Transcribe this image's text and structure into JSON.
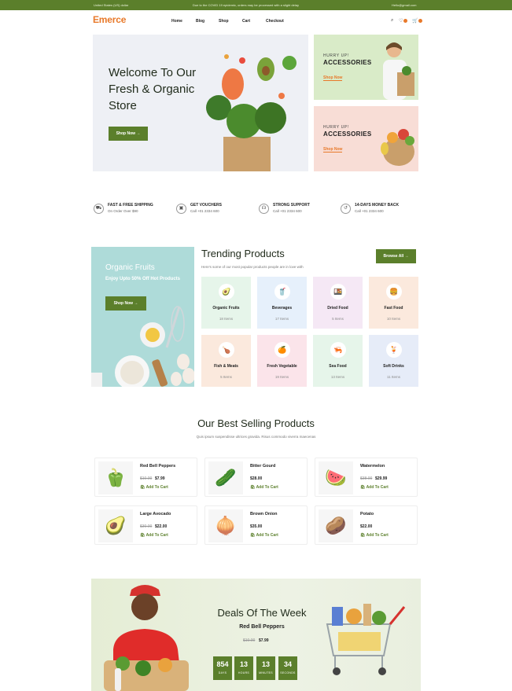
{
  "topbar": {
    "region": "United States (US) dollar",
    "notice": "Due to the COVID 19 epidemic, orders may be processed with a slight delay",
    "email": "Hello@gmail.com"
  },
  "header": {
    "logo": "Emerce",
    "nav": [
      "Home",
      "Blog",
      "Shop",
      "Cart",
      "Checkout"
    ]
  },
  "hero": {
    "title": "Welcome To Our Fresh & Organic Store",
    "cta": "Shop Now →"
  },
  "promos": [
    {
      "eyebrow": "HURRY UP!",
      "title": "ACCESSORIES",
      "link": "Shop Now",
      "bg": "#d9ebc8"
    },
    {
      "eyebrow": "HURRY UP!",
      "title": "ACCESSORIES",
      "link": "Shop Now",
      "bg": "#f8ddd6"
    }
  ],
  "features": [
    {
      "icon": "truck-icon",
      "title": "FAST & FREE SHIPPING",
      "sub": "On Order Over $90"
    },
    {
      "icon": "gift-icon",
      "title": "GET VOUCHERS",
      "sub": "Call +01 2334 600"
    },
    {
      "icon": "headset-icon",
      "title": "STRONG SUPPORT",
      "sub": "Call +01 2334 600"
    },
    {
      "icon": "refund-icon",
      "title": "14-DAYS MONEY BACK",
      "sub": "Call +01 2334 600"
    }
  ],
  "side_banner": {
    "title": "Organic Fruits",
    "subtitle": "Enjoy Upto 50% Off Hot Products",
    "cta": "Shop Now →"
  },
  "trending": {
    "title": "Trending Products",
    "subtitle": "Here's some of our most popular products people are in love with",
    "browse": "Browse All →",
    "categories": [
      {
        "name": "Organic Fruits",
        "count": "18 Items",
        "bg": "#e6f5ea",
        "icon": "🥑"
      },
      {
        "name": "Beverages",
        "count": "17 Items",
        "bg": "#e6f0fb",
        "icon": "🥤"
      },
      {
        "name": "Dried Food",
        "count": "5 Items",
        "bg": "#f5e8f5",
        "icon": "🍱"
      },
      {
        "name": "Fast Food",
        "count": "10 Items",
        "bg": "#fbe9dd",
        "icon": "🍔"
      },
      {
        "name": "Fish & Meats",
        "count": "5 Items",
        "bg": "#fbe9dd",
        "icon": "🍗"
      },
      {
        "name": "Fresh Vegetable",
        "count": "19 Items",
        "bg": "#fbe4ea",
        "icon": "🍊"
      },
      {
        "name": "Sea Food",
        "count": "13 Items",
        "bg": "#e6f5ea",
        "icon": "🦐"
      },
      {
        "name": "Soft Drinks",
        "count": "11 Items",
        "bg": "#e6ecf8",
        "icon": "🍹"
      }
    ]
  },
  "best_selling": {
    "title": "Our Best Selling Products",
    "subtitle": "Quis ipsum suspendisse ultrices gravida. Risus commodo viverra maecenas",
    "cart_label": "Add To Cart",
    "products": [
      {
        "name": "Red Bell Peppers",
        "old": "$10.00",
        "price": "$7.99",
        "icon": "🫑"
      },
      {
        "name": "Bitter Gourd",
        "old": "",
        "price": "$28.00",
        "icon": "🥒"
      },
      {
        "name": "Watermelon",
        "old": "$38.00",
        "price": "$29.99",
        "icon": "🍉"
      },
      {
        "name": "Large Avocado",
        "old": "$30.00",
        "price": "$22.00",
        "icon": "🥑"
      },
      {
        "name": "Brown Onion",
        "old": "",
        "price": "$35.00",
        "icon": "🧅"
      },
      {
        "name": "Potato",
        "old": "",
        "price": "$22.00",
        "icon": "🥔"
      }
    ]
  },
  "deals": {
    "title": "Deals Of The Week",
    "product": "Red Bell Peppers",
    "old": "$10.00",
    "price": "$7.99",
    "countdown": [
      {
        "value": "854",
        "label": "DAYS"
      },
      {
        "value": "13",
        "label": "HOURS"
      },
      {
        "value": "13",
        "label": "MINUTES"
      },
      {
        "value": "34",
        "label": "SECONDS"
      }
    ]
  }
}
